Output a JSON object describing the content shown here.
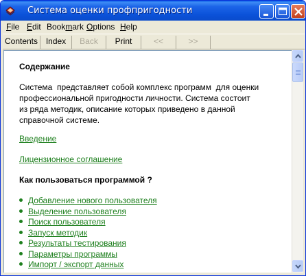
{
  "window": {
    "title": "Система оценки профпригодности"
  },
  "menu": [
    {
      "label": "File",
      "key": "F",
      "rest": "ile"
    },
    {
      "label": "Edit",
      "key": "E",
      "rest": "dit"
    },
    {
      "label": "Bookmark",
      "pre": "Book",
      "key": "m",
      "rest": "ark"
    },
    {
      "label": "Options",
      "key": "O",
      "rest": "ptions"
    },
    {
      "label": "Help",
      "key": "H",
      "rest": "elp"
    }
  ],
  "toolbar": {
    "contents": "Contents",
    "index": "Index",
    "back": "Back",
    "print": "Print",
    "prev": "<<",
    "next": ">>"
  },
  "content": {
    "heading": "Содержание",
    "paragraph_lines": [
      "Система  представляет собой комплекс программ  для оценки",
      "профессиональной пригодности личности. Система состоит",
      "из ряда методик, описание которых приведено в данной",
      "справочной системе."
    ],
    "link_intro": "Введение",
    "link_license": "Лицензионное соглашение",
    "subheading": "Как пользоваться программой ?",
    "topics": [
      "Добавление нового пользователя",
      "Выделение пользователя",
      "Поиск пользователя",
      "Запуск методик",
      "Результаты тестирования",
      "Параметры программы",
      "Импорт / экспорт данных"
    ]
  },
  "colors": {
    "link": "#1d7f1d",
    "titlebar": "#0b52d9",
    "close_button": "#c5411e"
  }
}
